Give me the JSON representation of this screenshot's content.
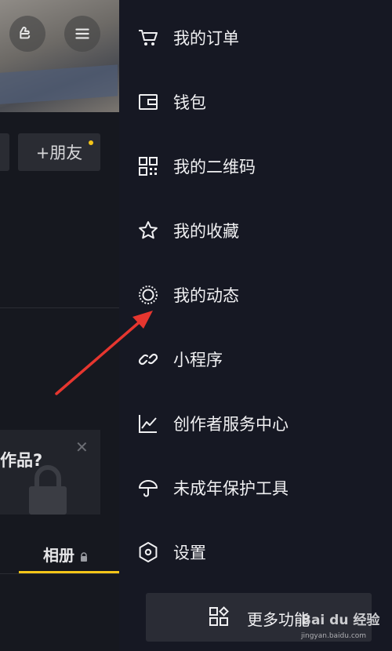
{
  "left": {
    "friends_button": "+朋友",
    "card_text": "作品?",
    "album_tab": "相册"
  },
  "menu": [
    {
      "icon": "cart-icon",
      "label": "我的订单"
    },
    {
      "icon": "wallet-icon",
      "label": "钱包"
    },
    {
      "icon": "qrcode-icon",
      "label": "我的二维码"
    },
    {
      "icon": "star-icon",
      "label": "我的收藏"
    },
    {
      "icon": "moments-icon",
      "label": "我的动态"
    },
    {
      "icon": "link-icon",
      "label": "小程序"
    },
    {
      "icon": "chart-icon",
      "label": "创作者服务中心"
    },
    {
      "icon": "umbrella-icon",
      "label": "未成年保护工具"
    },
    {
      "icon": "hexagon-settings-icon",
      "label": "设置"
    }
  ],
  "more_button": "更多功能",
  "watermark": {
    "brand": "Bai du 经验",
    "url": "jingyan.baidu.com"
  },
  "colors": {
    "panel_bg": "#161823",
    "accent": "#f5c518",
    "arrow": "#e6362f"
  }
}
